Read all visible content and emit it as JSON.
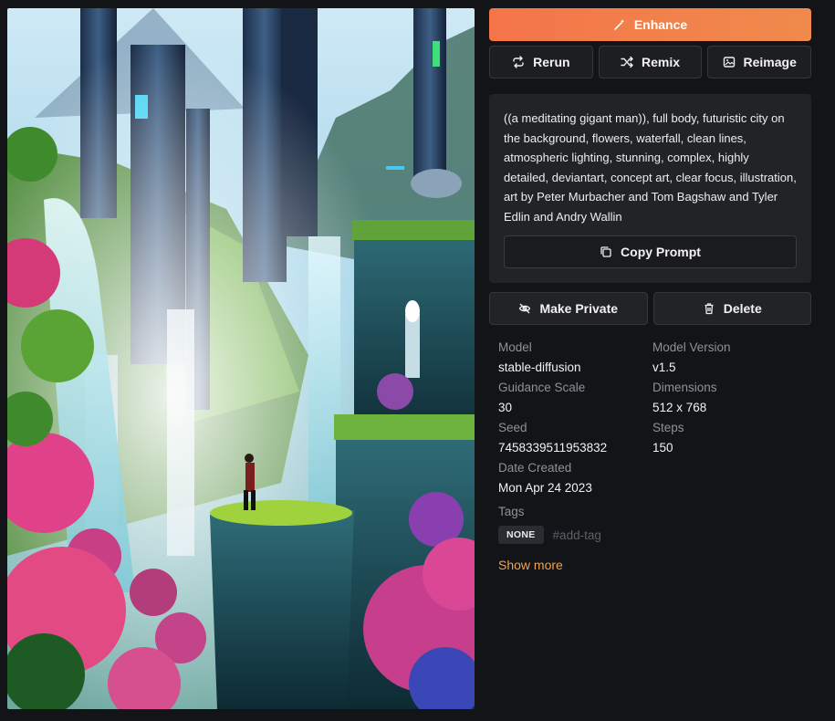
{
  "image": {
    "alt": ""
  },
  "buttons": {
    "enhance": "Enhance",
    "rerun": "Rerun",
    "remix": "Remix",
    "reimage": "Reimage",
    "copy_prompt": "Copy Prompt",
    "make_private": "Make Private",
    "delete": "Delete"
  },
  "prompt": "((a meditating gigant man)), full body, futuristic city on the background, flowers, waterfall, clean lines, atmospheric lighting, stunning, complex, highly detailed, deviantart, concept art, clear focus, illustration, art by Peter Murbacher and Tom Bagshaw and Tyler Edlin and Andry Wallin",
  "details": {
    "model_label": "Model",
    "model": "stable-diffusion",
    "version_label": "Model Version",
    "version": "v1.5",
    "guidance_label": "Guidance Scale",
    "guidance": "30",
    "dimensions_label": "Dimensions",
    "dimensions": "512 x 768",
    "seed_label": "Seed",
    "seed": "7458339511953832",
    "steps_label": "Steps",
    "steps": "150",
    "date_label": "Date Created",
    "date": "Mon Apr 24 2023",
    "tags_label": "Tags"
  },
  "tags": {
    "none": "NONE",
    "add": "#add-tag"
  },
  "show_more": "Show more",
  "colors": {
    "accent": "#f47549",
    "link": "#f2a34a",
    "panel": "#222327",
    "background": "#131417"
  }
}
